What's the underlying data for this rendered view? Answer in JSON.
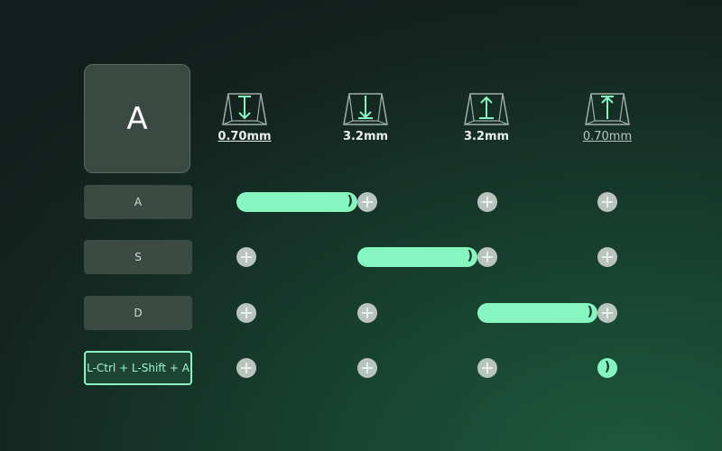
{
  "key_preview": {
    "label": "A"
  },
  "columns": [
    {
      "icon": "key-press-down-arrow-icon",
      "value": "0.70mm"
    },
    {
      "icon": "key-press-bottom-arrow-icon",
      "value": "3.2mm"
    },
    {
      "icon": "key-release-up-arrow-icon",
      "value": "3.2mm"
    },
    {
      "icon": "key-release-top-arrow-icon",
      "value": "0.70mm"
    }
  ],
  "rows": [
    {
      "label": "A"
    },
    {
      "label": "S"
    },
    {
      "label": "D"
    },
    {
      "label": "L-Ctrl + L-Shift + A"
    }
  ],
  "bar_cap": ")",
  "colors": {
    "accent": "#86f5bf",
    "background": "#142520"
  }
}
